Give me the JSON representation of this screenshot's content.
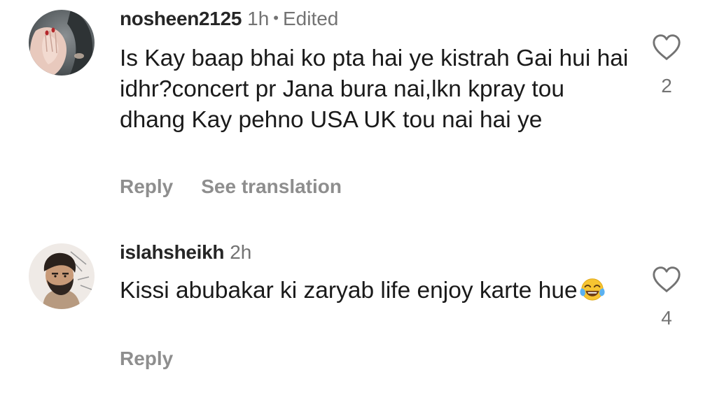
{
  "comments": [
    {
      "username": "nosheen2125",
      "time": "1h",
      "separator": "•",
      "edited": "Edited",
      "text": "Is Kay baap bhai ko pta hai ye kistrah Gai hui hai idhr?concert pr Jana bura nai,lkn kpray tou dhang Kay pehno USA UK tou nai hai ye",
      "reply_label": "Reply",
      "translation_label": "See translation",
      "likes": "2",
      "avatar_icon": "profile-photo-hand-hair",
      "like_icon": "heart-outline-icon"
    },
    {
      "username": "islahsheikh",
      "time": "2h",
      "text": "Kissi abubakar ki zaryab life enjoy karte hue",
      "emoji": "face-with-tears-of-joy-icon",
      "reply_label": "Reply",
      "likes": "4",
      "avatar_icon": "profile-photo-bearded-man",
      "like_icon": "heart-outline-icon"
    }
  ],
  "colors": {
    "primary_text": "#1a1a1a",
    "username": "#262626",
    "secondary_text": "#737373",
    "action_text": "#8e8e8e",
    "background": "#ffffff"
  }
}
